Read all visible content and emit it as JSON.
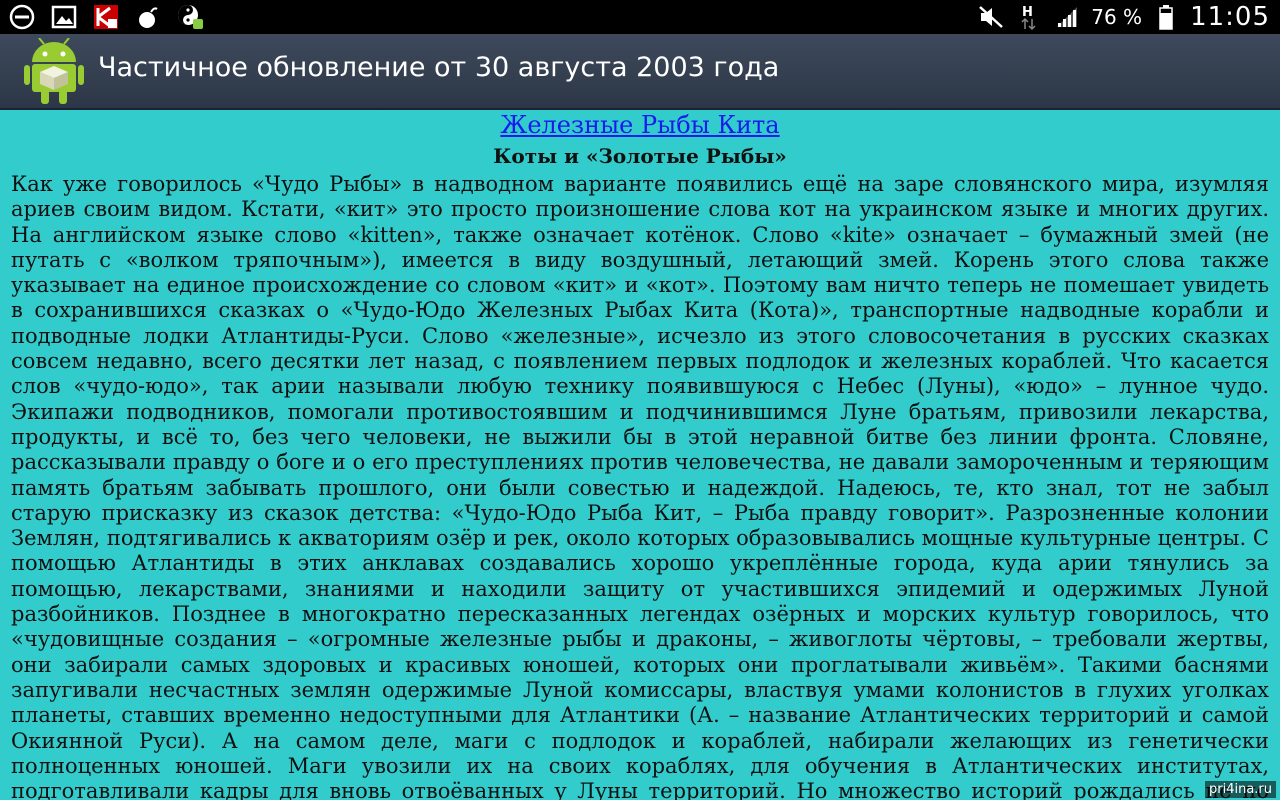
{
  "status_bar": {
    "left_icons": [
      "no-entry-icon",
      "gallery-icon",
      "kaspersky-icon",
      "bomb-icon",
      "yin-yang-android-icon"
    ],
    "right_icons": [
      "mute-icon",
      "network-h-icon",
      "signal-icon"
    ],
    "battery_text": "76 %",
    "time": "11:05"
  },
  "action_bar": {
    "title": "Частичное обновление от 30 августа 2003 года",
    "icon": "android-app-icon"
  },
  "article": {
    "link_title": "Железные Рыбы Кита",
    "subtitle": "Коты и «Золотые Рыбы»",
    "body": "Как уже говорилось «Чудо Рыбы» в надводном варианте появились ещё на заре словянского мира, изумляя ариев своим видом. Кстати, «кит» это просто произношение слова кот на украинском языке и многих других. На английском языке слово «kitten», также означает котёнок. Слово «kite» означает – бумажный змей (не путать с «волком тряпочным»), имеется в виду воздушный, летающий змей. Корень этого слова также указывает на единое происхождение со словом «кит» и «кот». Поэтому вам ничто теперь не помешает увидеть в сохранившихся сказках о «Чудо-Юдо Железных Рыбах Кита (Кота)», транспортные надводные корабли и подводные лодки Атлантиды-Руси. Слово «железные», исчезло из этого словосочетания в русских сказках совсем недавно, всего десятки лет назад, с появлением первых подлодок и железных кораблей. Что касается слов «чудо-юдо», так арии называли любую технику появившуюся с Небес (Луны), «юдо» – лунное чудо. Экипажи подводников, помогали противостоявшим и подчинившимся Луне братьям, привозили лекарства, продукты, и всё то, без чего человеки, не выжили бы в этой неравной битве без линии фронта. Словяне, рассказывали правду о боге и о его преступлениях против человечества, не давали замороченным и теряющим память братьям забывать прошлого, они были совестью и надеждой. Надеюсь, те, кто знал, тот не забыл старую присказку из сказок детства: «Чудо-Юдо Рыба Кит, – Рыба правду говорит». Разрозненные колонии Землян, подтягивались к акваториям озёр и рек, около которых образовывались мощные культурные центры. С помощью Атлантиды в этих анклавах создавались хорошо укреплённые города, куда арии тянулись за помощью, лекарствами, знаниями и находили защиту от участившихся эпидемий и одержимых Луной разбойников. Позднее в многократно пересказанных легендах озёрных и морских культур говорилось, что «чудовищные создания – «огромные железные рыбы и драконы, – живоглоты чёртовы, – требовали жертвы, они забирали самых здоровых и красивых юношей, которых они проглатывали живьём». Такими баснями запугивали несчастных землян одержимые Луной комиссары, властвуя умами колонистов в глухих уголках планеты, ставших временно недоступными для Атлантики (А. – название Атлантических территорий и самой Окиянной Руси). А на самом деле, маги с подлодок и кораблей, набирали желающих из генетически полноценных юношей. Маги увозили их на своих кораблях, для обучения в Атлантических институтах, подготавливали кадры для вновь отвоёванных у Луны территорий. Но множество историй рождались не по злому умыслу, а от «простоты душевной» – вызванной вирусным поражением мозга"
  },
  "watermark": "pri4ina.ru"
}
